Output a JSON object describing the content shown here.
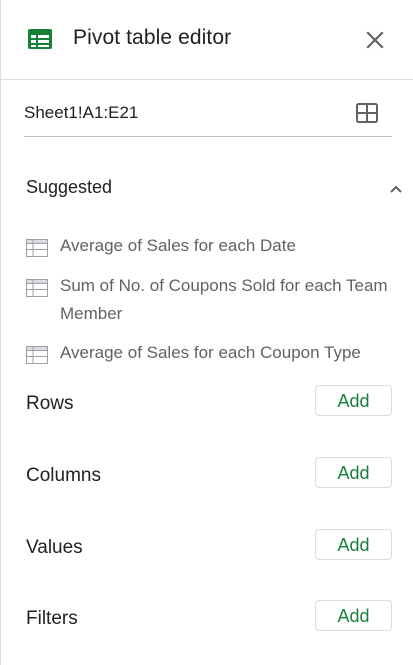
{
  "header": {
    "title": "Pivot table editor",
    "icon": "sheets-table-icon",
    "close_icon": "close-icon"
  },
  "range": {
    "value": "Sheet1!A1:E21",
    "icon": "select-range-icon"
  },
  "suggested": {
    "title": "Suggested",
    "expanded": true,
    "items": [
      {
        "label": "Average of Sales for each Date",
        "icon": "pivot-table-icon"
      },
      {
        "label": "Sum of No. of Coupons Sold for each Team Member",
        "icon": "pivot-table-icon"
      },
      {
        "label": "Average of Sales for each Coupon Type",
        "icon": "pivot-table-icon"
      }
    ]
  },
  "sections": [
    {
      "label": "Rows",
      "button": "Add"
    },
    {
      "label": "Columns",
      "button": "Add"
    },
    {
      "label": "Values",
      "button": "Add"
    },
    {
      "label": "Filters",
      "button": "Add"
    }
  ],
  "colors": {
    "accent": "#188038",
    "icon_green": "#188038",
    "text": "#202124",
    "muted_text": "#5f6368",
    "border": "#dadce0"
  }
}
